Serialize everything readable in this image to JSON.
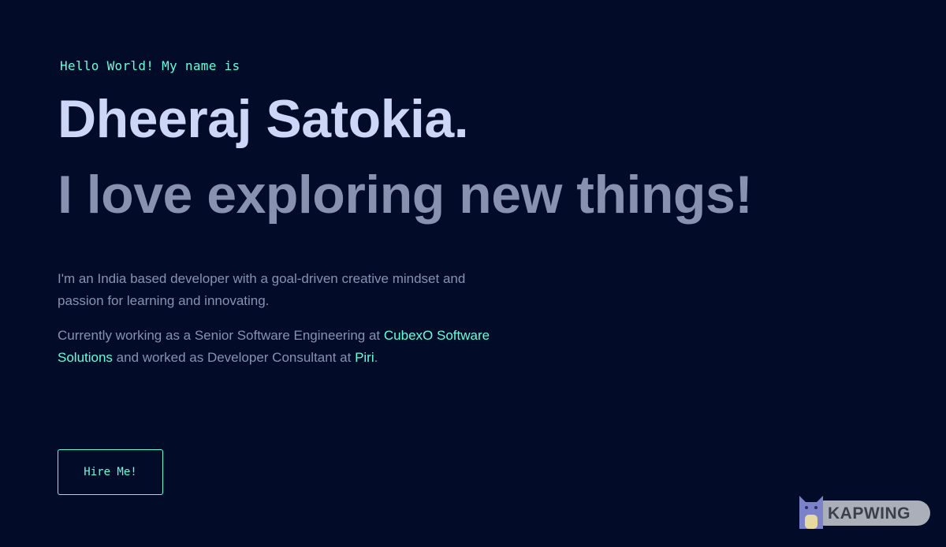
{
  "hero": {
    "greeting": "Hello World! My name is",
    "name": "Dheeraj Satokia.",
    "tagline": "I love exploring new things!"
  },
  "bio": {
    "paragraph1": "I'm an India based developer with a goal-driven creative mindset and passion for learning and innovating.",
    "paragraph2_part1": "Currently working as a Senior Software Engineering at ",
    "company_link": "CubexO Software Solutions",
    "paragraph2_part2": " and worked as Developer Consultant at ",
    "previous_link": "Piri",
    "paragraph2_end": "."
  },
  "cta": {
    "hire_label": "Hire Me!"
  },
  "watermark": {
    "text": "KAPWING",
    "icon": "kapwing-cat-logo"
  },
  "colors": {
    "background": "#020c29",
    "accent": "#64ffda",
    "heading": "#ccd6f6",
    "muted": "#8892b0"
  }
}
